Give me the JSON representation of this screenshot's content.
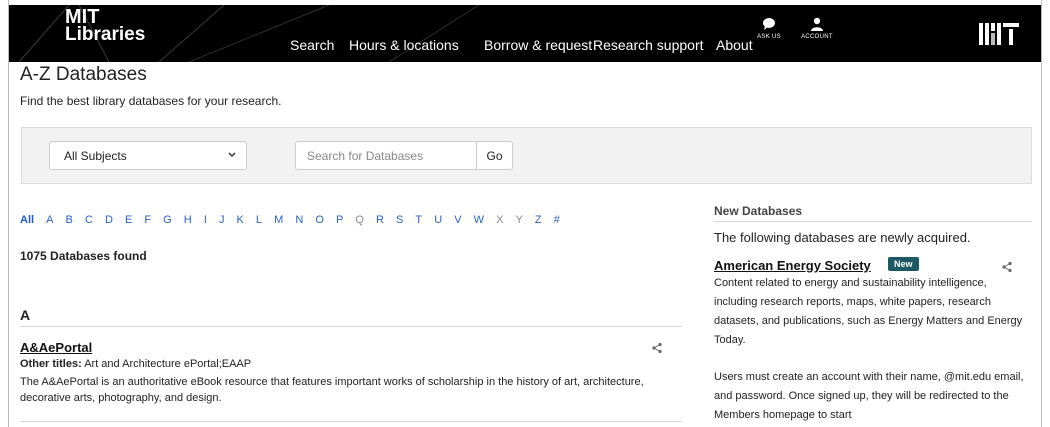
{
  "header": {
    "logo_line1": "MIT",
    "logo_line2": "Libraries",
    "nav": [
      "Search",
      "Hours & locations",
      "Borrow & request",
      "Research support",
      "About"
    ],
    "ask_us": "ASK US",
    "account": "ACCOUNT",
    "bg_color": "#000000"
  },
  "page": {
    "title": "A-Z Databases",
    "subtitle": "Find the best library databases for your research."
  },
  "filters": {
    "subject_selected": "All Subjects",
    "search_placeholder": "Search for Databases",
    "go_label": "Go"
  },
  "alphabet": {
    "all": "All",
    "letters": [
      "A",
      "B",
      "C",
      "D",
      "E",
      "F",
      "G",
      "H",
      "I",
      "J",
      "K",
      "L",
      "M",
      "N",
      "O",
      "P",
      "Q",
      "R",
      "S",
      "T",
      "U",
      "V",
      "W",
      "X",
      "Y",
      "Z",
      "#"
    ],
    "dimmed": [
      "P",
      "Q",
      "X",
      "Y"
    ]
  },
  "results": {
    "count_text": "1075 Databases found",
    "section_letter": "A",
    "items": [
      {
        "title": "A&AePortal",
        "other_titles_label": "Other titles:",
        "other_titles_value": "Art and Architecture ePortal;EAAP",
        "description": "The A&AePortal is an authoritative eBook resource that features important works of scholarship in the history of art, architecture, decorative arts, photography, and design."
      }
    ]
  },
  "sidebar": {
    "heading": "New Databases",
    "intro": "The following databases are newly acquired.",
    "item_title": "American Energy Society",
    "badge": "New",
    "item_desc": "Content related to energy and sustainability intelligence, including research reports, maps, white papers, research datasets, and publications, such as Energy Matters and Energy Today.",
    "item_desc2": "Users must create an account with their name, @mit.edu email, and password. Once signed up, they will be redirected to the Members homepage to start"
  },
  "colors": {
    "link_blue": "#2b61c5",
    "badge_bg": "#1d5865",
    "filter_bg": "#f2f2f2"
  }
}
